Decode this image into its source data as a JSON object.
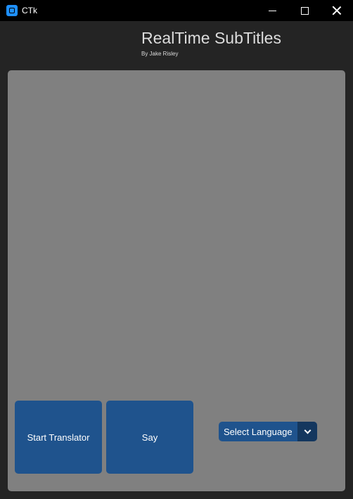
{
  "window": {
    "title": "CTk",
    "controls": [
      "minimize",
      "maximize",
      "close"
    ]
  },
  "header": {
    "title": "RealTime SubTitles",
    "byline": "By Jake Risley"
  },
  "controls": {
    "start_button": "Start Translator",
    "say_button": "Say",
    "language_select": {
      "selected": "Select Language"
    }
  },
  "colors": {
    "background": "#242424",
    "panel": "#808080",
    "button": "#1f538d",
    "dropdown_arrow_bg": "#14375e",
    "titlebar": "#000000"
  }
}
